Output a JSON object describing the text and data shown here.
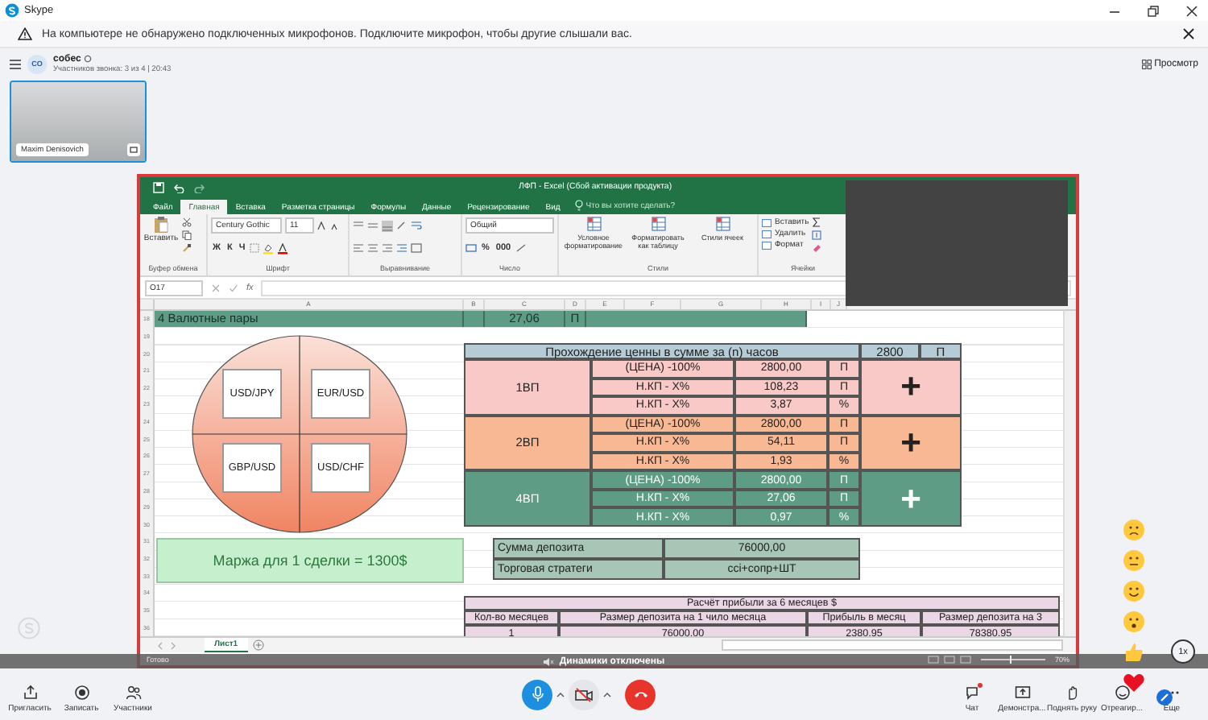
{
  "window": {
    "title": "Skype"
  },
  "notification": {
    "text": "На компьютере не обнаружено подключенных микрофонов. Подключите микрофон, чтобы другие слышали вас."
  },
  "call_header": {
    "avatar": "CO",
    "title": "собес",
    "subtitle": "Участников звонка: 3 из 4 | 20:43",
    "view_button": "Просмотр"
  },
  "participants": [
    {
      "name": "Maxim Denisovich",
      "selected": true
    }
  ],
  "excel": {
    "title": "ЛФП - Excel (Сбой активации продукта)",
    "tabs": [
      {
        "label": "Файл",
        "selected": false
      },
      {
        "label": "Главная",
        "selected": true
      },
      {
        "label": "Вставка",
        "selected": false
      },
      {
        "label": "Разметка страницы",
        "selected": false
      },
      {
        "label": "Формулы",
        "selected": false
      },
      {
        "label": "Данные",
        "selected": false
      },
      {
        "label": "Рецензирование",
        "selected": false
      },
      {
        "label": "Вид",
        "selected": false
      }
    ],
    "tell_me": "Что вы хотите сделать?",
    "ribbon": [
      {
        "kind": "clipboard",
        "label": "Буфер обмена",
        "button": "Вставить"
      },
      {
        "kind": "font",
        "label": "Шрифт",
        "font": "Century Gothic",
        "size": "11",
        "styles": [
          "Ж",
          "К",
          "Ч"
        ]
      },
      {
        "kind": "align",
        "label": "Выравнивание"
      },
      {
        "kind": "number",
        "label": "Число",
        "format": "Общий",
        "symbols": [
          "%",
          "000"
        ]
      },
      {
        "kind": "styles",
        "label": "Стили",
        "buttons": [
          "Условное форматирование",
          "Форматировать как таблицу",
          "Стили ячеек"
        ]
      },
      {
        "kind": "cells",
        "label": "Ячейки",
        "buttons": [
          "Вставить",
          "Удалить",
          "Формат"
        ]
      }
    ],
    "name_box": "O17",
    "formula_label": "fx",
    "columns": [
      "A",
      "B",
      "C",
      "D",
      "E",
      "F",
      "G",
      "H",
      "I",
      "J"
    ],
    "rows": [
      "18",
      "19",
      "20",
      "21",
      "22",
      "23",
      "24",
      "25",
      "26",
      "27",
      "28",
      "29",
      "30",
      "31",
      "32",
      "33",
      "34",
      "35",
      "36"
    ],
    "band": {
      "label": "4 Валютные пары",
      "value": "27,06",
      "unit": "П"
    },
    "pie_labels": [
      "USD/JPY",
      "EUR/USD",
      "GBP/USD",
      "USD/CHF"
    ],
    "price_table": {
      "title": "Прохождение ценны в сумме за (n) часов",
      "value": "2800",
      "unit": "П",
      "groups": [
        {
          "name": "1ВП",
          "color": "#f8c9c7",
          "sign": "+",
          "rows": [
            {
              "label": "(ЦЕНА) -100%",
              "value": "2800,00",
              "unit": "П"
            },
            {
              "label": "Н.КП - X%",
              "value": "108,23",
              "unit": "П"
            },
            {
              "label": "Н.КП - X%",
              "value": "3,87",
              "unit": "%"
            }
          ]
        },
        {
          "name": "2ВП",
          "color": "#f8b894",
          "sign": "+",
          "rows": [
            {
              "label": "(ЦЕНА) -100%",
              "value": "2800,00",
              "unit": "П"
            },
            {
              "label": "Н.КП - X%",
              "value": "54,11",
              "unit": "П"
            },
            {
              "label": "Н.КП - X%",
              "value": "1,93",
              "unit": "%"
            }
          ]
        },
        {
          "name": "4ВП",
          "color": "#5f9c85",
          "sign": "+",
          "rows": [
            {
              "label": "(ЦЕНА) -100%",
              "value": "2800,00",
              "unit": "П"
            },
            {
              "label": "Н.КП - X%",
              "value": "27,06",
              "unit": "П"
            },
            {
              "label": "Н.КП - X%",
              "value": "0,97",
              "unit": "%"
            }
          ]
        }
      ]
    },
    "margin": "Маржа для 1 сделки = 1300$",
    "deposit": [
      {
        "label": "Сумма депозита",
        "value": "76000,00"
      },
      {
        "label": "Торговая стратеги",
        "value": "cci+сопр+ШТ"
      }
    ],
    "profit_table": {
      "title": "Расчёт прибыли за 6 месяцев $",
      "columns": [
        "Кол-во месяцев",
        "Размер депозита на 1 чило месяца",
        "Прибыль в месяц",
        "Размер депозита на 3"
      ],
      "rows": [
        [
          "1",
          "76000,00",
          "2380,95",
          "78380,95"
        ]
      ]
    },
    "sheets": [
      {
        "label": "Лист1",
        "selected": true
      }
    ],
    "status": "Готово",
    "zoom_slider": {
      "level": 0.45
    },
    "zoom": "70%"
  },
  "speaker_notice": "Динамики отключены",
  "toolbar": {
    "left": [
      "Пригласить",
      "Записать",
      "Участники"
    ],
    "controls": [
      {
        "kind": "mic",
        "on": true
      },
      {
        "kind": "camera",
        "on": false
      },
      {
        "kind": "hangup"
      }
    ],
    "right": [
      {
        "kind": "chat",
        "label": "Чат",
        "unread": true
      },
      {
        "kind": "share",
        "label": "Демонстра..."
      },
      {
        "kind": "hand",
        "label": "Поднять руку"
      },
      {
        "kind": "react",
        "label": "Отреагир..."
      },
      {
        "kind": "more",
        "label": "Еще"
      }
    ]
  },
  "speed_badge": "1x"
}
